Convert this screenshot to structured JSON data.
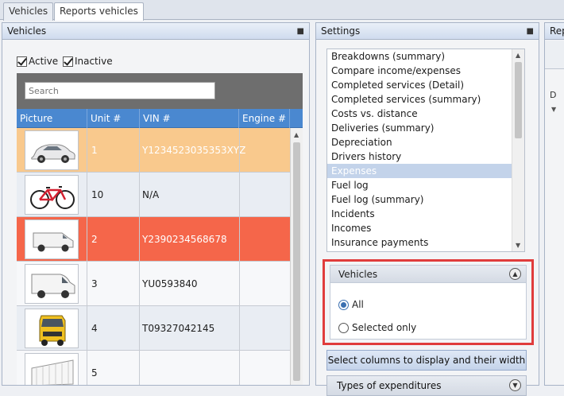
{
  "tabs": [
    {
      "label": "Vehicles",
      "active": false
    },
    {
      "label": "Reports vehicles",
      "active": true
    }
  ],
  "vehicles_panel": {
    "title": "Vehicles",
    "filters": {
      "active_label": "Active",
      "active_checked": true,
      "inactive_label": "Inactive",
      "inactive_checked": true
    },
    "search_placeholder": "Search",
    "columns": [
      "Picture",
      "Unit #",
      "VIN #",
      "Engine #"
    ],
    "rows": [
      {
        "picture": "car-icon",
        "unit": "1",
        "vin": "Y1234523035353XYZ",
        "engine": "",
        "highlight": "orange"
      },
      {
        "picture": "bicycle-icon",
        "unit": "10",
        "vin": "N/A",
        "engine": "",
        "highlight": "none"
      },
      {
        "picture": "van-icon",
        "unit": "2",
        "vin": "Y2390234568678",
        "engine": "",
        "highlight": "red"
      },
      {
        "picture": "van-icon",
        "unit": "3",
        "vin": "YU0593840",
        "engine": "",
        "highlight": "none"
      },
      {
        "picture": "truck-icon",
        "unit": "4",
        "vin": "T09327042145",
        "engine": "",
        "highlight": "none"
      },
      {
        "picture": "trailer-icon",
        "unit": "5",
        "vin": "",
        "engine": "",
        "highlight": "none"
      }
    ]
  },
  "settings_panel": {
    "title": "Settings",
    "reports": [
      "Breakdowns (summary)",
      "Compare income/expenses",
      "Completed services (Detail)",
      "Completed services (summary)",
      "Costs vs. distance",
      "Deliveries (summary)",
      "Depreciation",
      "Drivers history",
      "Expenses",
      "Fuel log",
      "Fuel log (summary)",
      "Incidents",
      "Incomes",
      "Insurance payments"
    ],
    "selected_report": "Expenses",
    "vehicles_group": {
      "title": "Vehicles",
      "options": [
        {
          "label": "All",
          "checked": true
        },
        {
          "label": "Selected only",
          "checked": false
        }
      ]
    },
    "select_columns_label": "Select columns to display and their width",
    "expenditures_label": "Types of expenditures"
  },
  "report_panel": {
    "title": "Repo",
    "header_letter": "D"
  },
  "colors": {
    "header_blue": "#4a88d0",
    "orange_row": "#f9c98d",
    "red_row": "#f5664a",
    "highlight_box": "#e03c3c",
    "selected_item": "#c3d3ea"
  }
}
